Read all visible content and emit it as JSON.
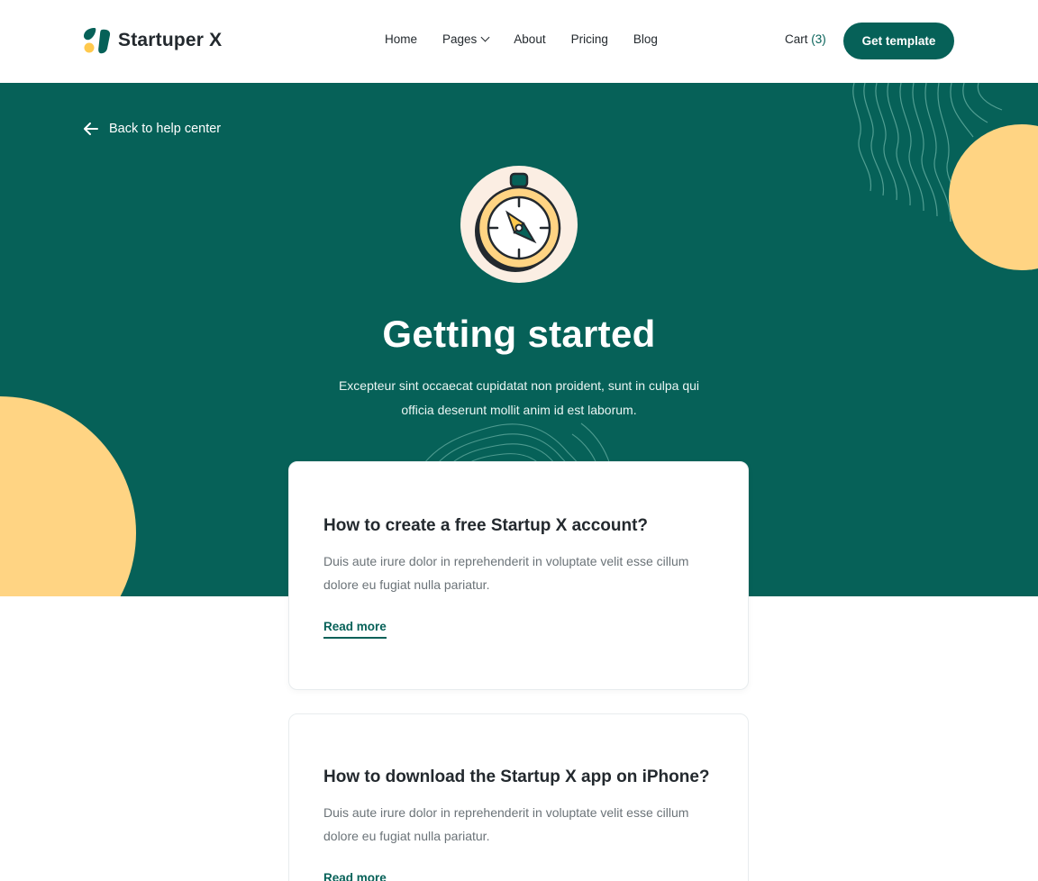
{
  "header": {
    "logo_text": "Startuper X",
    "nav": [
      {
        "label": "Home"
      },
      {
        "label": "Pages",
        "has_dropdown": true
      },
      {
        "label": "About"
      },
      {
        "label": "Pricing"
      },
      {
        "label": "Blog"
      }
    ],
    "cart_label": "Cart",
    "cart_count": "(3)",
    "cta_label": "Get template"
  },
  "hero": {
    "back_label": "Back to help center",
    "icon": "compass-icon",
    "title": "Getting started",
    "subtitle": "Excepteur sint occaecat cupidatat non proident, sunt in culpa qui officia deserunt mollit anim id est laborum."
  },
  "articles": [
    {
      "title": "How to create a free Startup X account?",
      "body": "Duis aute irure dolor in reprehenderit in voluptate velit esse cillum dolore eu fugiat nulla pariatur.",
      "link": "Read more"
    },
    {
      "title": "How to download the Startup X app on iPhone?",
      "body": "Duis aute irure dolor in reprehenderit in voluptate velit esse cillum dolore eu fugiat nulla pariatur.",
      "link": "Read more"
    }
  ],
  "colors": {
    "primary": "#066158",
    "accent": "#ffd483",
    "text": "#23292e",
    "muted": "#6b7378"
  }
}
